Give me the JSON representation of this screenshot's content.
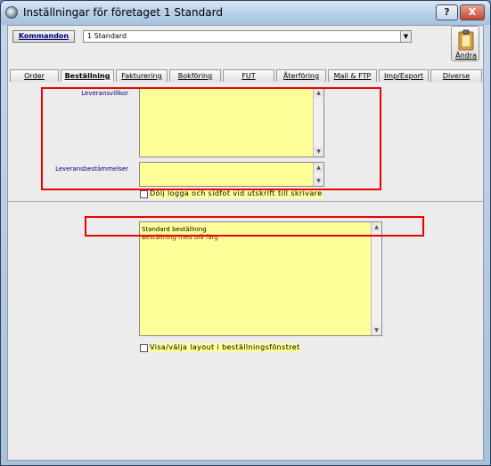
{
  "window": {
    "title": "Inställningar för företaget 1 Standard",
    "help_label": "?",
    "close_label": "X"
  },
  "toolbar": {
    "kommandon_label": "Kommandon",
    "company_value": "1 Standard",
    "andra_label": "Ändra"
  },
  "tabs": [
    {
      "label": "Order"
    },
    {
      "label": "Beställning"
    },
    {
      "label": "Fakturering"
    },
    {
      "label": "Bokföring"
    },
    {
      "label": "FUT"
    },
    {
      "label": "Återföring"
    },
    {
      "label": "Mail & FTP"
    },
    {
      "label": "Imp/Export"
    },
    {
      "label": "Diverse"
    }
  ],
  "order_panel": {
    "leveransvillkor_label": "Leveransvillkor",
    "leveransbestammelser_label": "Leveransbestämmelser",
    "hide_logo_label": "Dölj logga och sidfot vid utskrift till skrivare"
  },
  "layout_list": {
    "items": [
      "Standard beställning",
      "Beställning med blå färg"
    ],
    "show_layout_label": "Visa/välja layout i beställningsfönstret"
  },
  "colors": {
    "field_yellow": "#ffff99",
    "highlight_red": "#ee0000",
    "label_blue": "#000080"
  }
}
